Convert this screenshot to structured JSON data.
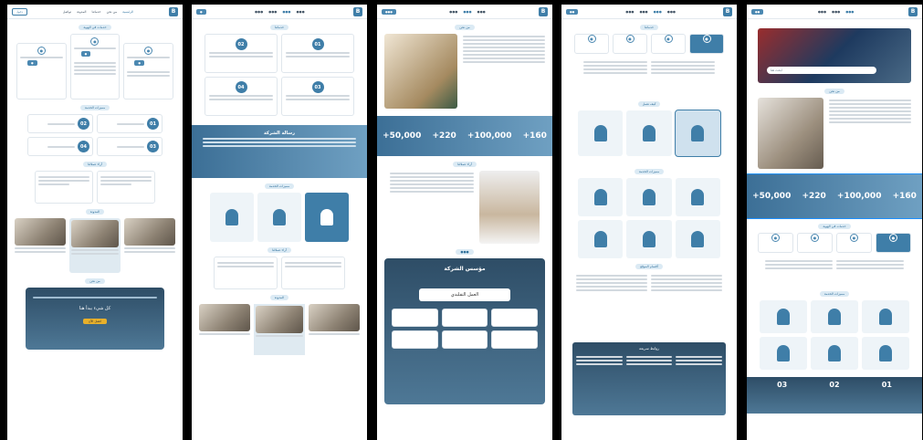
{
  "panels": [
    {
      "id": "p1",
      "nav_links": [
        "الرئيسية",
        "من نحن",
        "خدماتنا",
        "المدونة",
        "تواصل"
      ],
      "section_a": "خدمات في الهوية",
      "section_b": "مميزات الخدمة",
      "section_c": "آراء عملائنا",
      "section_d": "المدونة",
      "section_e": "من نحن",
      "cta_text": "كل شيء يبدأ هنا",
      "cta_button": "اتصل الآن",
      "numbers": [
        "02",
        "01",
        "04",
        "03"
      ]
    },
    {
      "id": "p2",
      "section_a": "خدماتنا",
      "banner_title": "رسالة الشركة",
      "section_b": "مميزات الخدمة",
      "section_c": "آراء عملائنا",
      "section_d": "المدونة",
      "numbers": [
        "02",
        "01",
        "04",
        "03"
      ]
    },
    {
      "id": "p3",
      "section_a": "من نحن",
      "stats": [
        "+50,000",
        "+220",
        "+100,000",
        "+160"
      ],
      "section_b": "آراء عملائنا",
      "team_title": "مؤسس الشركة",
      "team_name": "العمل التقليدي"
    },
    {
      "id": "p4",
      "section_a": "خدماتنا",
      "section_b": "كيف نعمل",
      "section_c": "مميزات الخدمة",
      "section_d": "أقسام الموقع",
      "footer_title": "روابط سريعة"
    },
    {
      "id": "p5",
      "search_placeholder": "ابحث هنا",
      "section_a": "من نحن",
      "stats": [
        "+50,000",
        "+220",
        "+100,000",
        "+160"
      ],
      "section_b": "خدمات في الهوية",
      "section_c": "مميزات الخدمة",
      "numbers": [
        "03",
        "02",
        "01"
      ]
    }
  ],
  "colors": {
    "accent": "#3f7ea8",
    "highlight": "#1e90ff",
    "cta": "#e8b02a"
  }
}
